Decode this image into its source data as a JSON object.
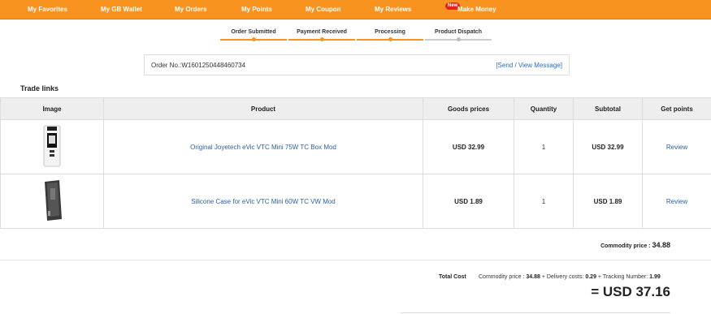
{
  "topnav": {
    "items": [
      {
        "label": "My Favorites"
      },
      {
        "label": "My GB Wallet"
      },
      {
        "label": "My Orders"
      },
      {
        "label": "My Points"
      },
      {
        "label": "My Coupon"
      },
      {
        "label": "My Reviews"
      },
      {
        "label": "Make Money",
        "badge": "New"
      }
    ],
    "accent_color": "#f7931e"
  },
  "progress": {
    "steps": [
      {
        "label": "Order Submitted",
        "done": true
      },
      {
        "label": "Payment Received",
        "done": true
      },
      {
        "label": "Processing",
        "done": true
      },
      {
        "label": "Product Dispatch",
        "done": false
      }
    ]
  },
  "order": {
    "number_text": "Order No.:W1601250448460734",
    "message_link": "[Send / View Message]"
  },
  "trade": {
    "title": "Trade links",
    "columns": [
      "Image",
      "Product",
      "Goods prices",
      "Quantity",
      "Subtotal",
      "Get points"
    ],
    "rows": [
      {
        "image": "evic-vtc-mini-box-mod-white",
        "product": "Original Joyetech eVic VTC Mini 75W TC Box Mod",
        "price": "USD 32.99",
        "quantity": "1",
        "subtotal": "USD 32.99",
        "points_link": "Review"
      },
      {
        "image": "silicone-case-grey",
        "product": "Silicone Case for eVic VTC Mini 60W TC VW Mod",
        "price": "USD 1.89",
        "quantity": "1",
        "subtotal": "USD 1.89",
        "points_link": "Review"
      }
    ]
  },
  "summary": {
    "commodity_label": "Commodity price :",
    "commodity_value": "34.88",
    "total_label": "Total Cost",
    "breakdown": {
      "commodity_label": "Commodity price :",
      "commodity_value": "34.88",
      "delivery_label": "+ Delivery costs:",
      "delivery_value": "0.29",
      "tracking_label": "+ Tracking Number:",
      "tracking_value": "1.99"
    },
    "grand_total": "= USD 37.16"
  }
}
